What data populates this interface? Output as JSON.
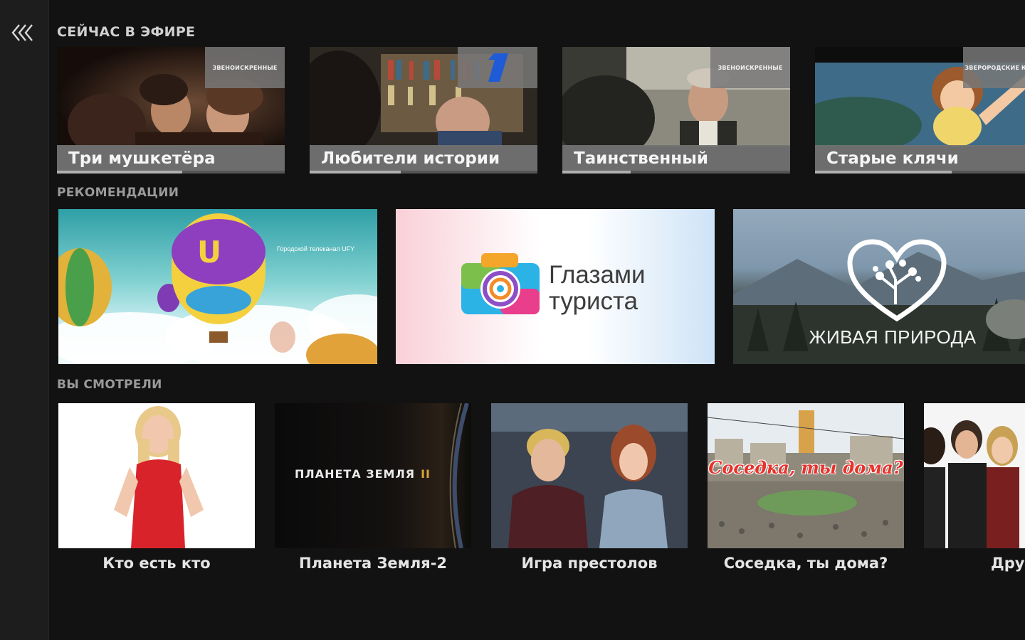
{
  "nav": {
    "back_icon": "double-chevron-left-icon"
  },
  "colors": {
    "background": "#121212",
    "rail": "#1d1d1d",
    "caption_bar": "#737373",
    "section_title": "#9a9a9a",
    "neighbor_title": "#e8322b",
    "planet_roman": "#d6a33b"
  },
  "sections": {
    "live": {
      "title": "Сейчас в эфире",
      "items": [
        {
          "title": "Три мушкетёра",
          "channel": "ЗВЕНОИСКРЕННЫЕ",
          "progress": 0.55
        },
        {
          "title": "Любители истории",
          "channel": "Первый",
          "progress": 0.4
        },
        {
          "title": "Таинственный",
          "channel": "ЗВЕНОИСКРЕННЫЕ",
          "progress": 0.3
        },
        {
          "title": "Старые клячи",
          "channel": "ЗВЕРОРОДСКИЕ КИНО",
          "progress": 0.6
        }
      ]
    },
    "recommendations": {
      "title": "Рекомендации",
      "items": [
        {
          "caption": "Городской телеканал UFY"
        },
        {
          "title": "Глазами\nтуриста"
        },
        {
          "title": "Живая природа"
        }
      ]
    },
    "watched": {
      "title": "Вы смотрели",
      "items": [
        {
          "title": "Кто есть кто"
        },
        {
          "title": "Планета Земля-2",
          "overlay": "ПЛАНЕТА ЗЕМЛЯ",
          "overlay_roman": "II"
        },
        {
          "title": "Игра престолов"
        },
        {
          "title": "Соседка, ты дома?",
          "overlay": "Соседка, ты дома?"
        },
        {
          "title": "Дру"
        }
      ]
    }
  }
}
